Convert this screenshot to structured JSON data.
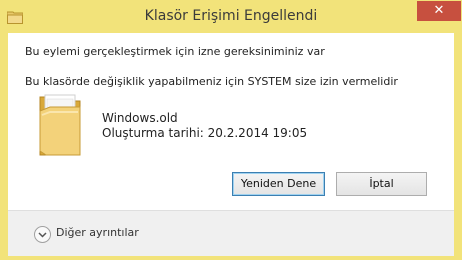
{
  "window": {
    "title": "Klasör Erişimi Engellendi",
    "close_glyph": "✕",
    "accent_color": "#f2e37a"
  },
  "messages": {
    "line1": "Bu eylemi gerçekleştirmek için izne gereksiniminiz var",
    "line2": "Bu klasörde değişiklik yapabilmeniz için SYSTEM size izin vermelidir"
  },
  "item": {
    "icon": "folder-icon",
    "name": "Windows.old",
    "created": "Oluşturma tarihi: 20.2.2014 19:05"
  },
  "buttons": {
    "retry": "Yeniden Dene",
    "cancel": "İptal"
  },
  "footer": {
    "more_details": "Diğer ayrıntılar",
    "icon": "chevron-down-icon"
  }
}
